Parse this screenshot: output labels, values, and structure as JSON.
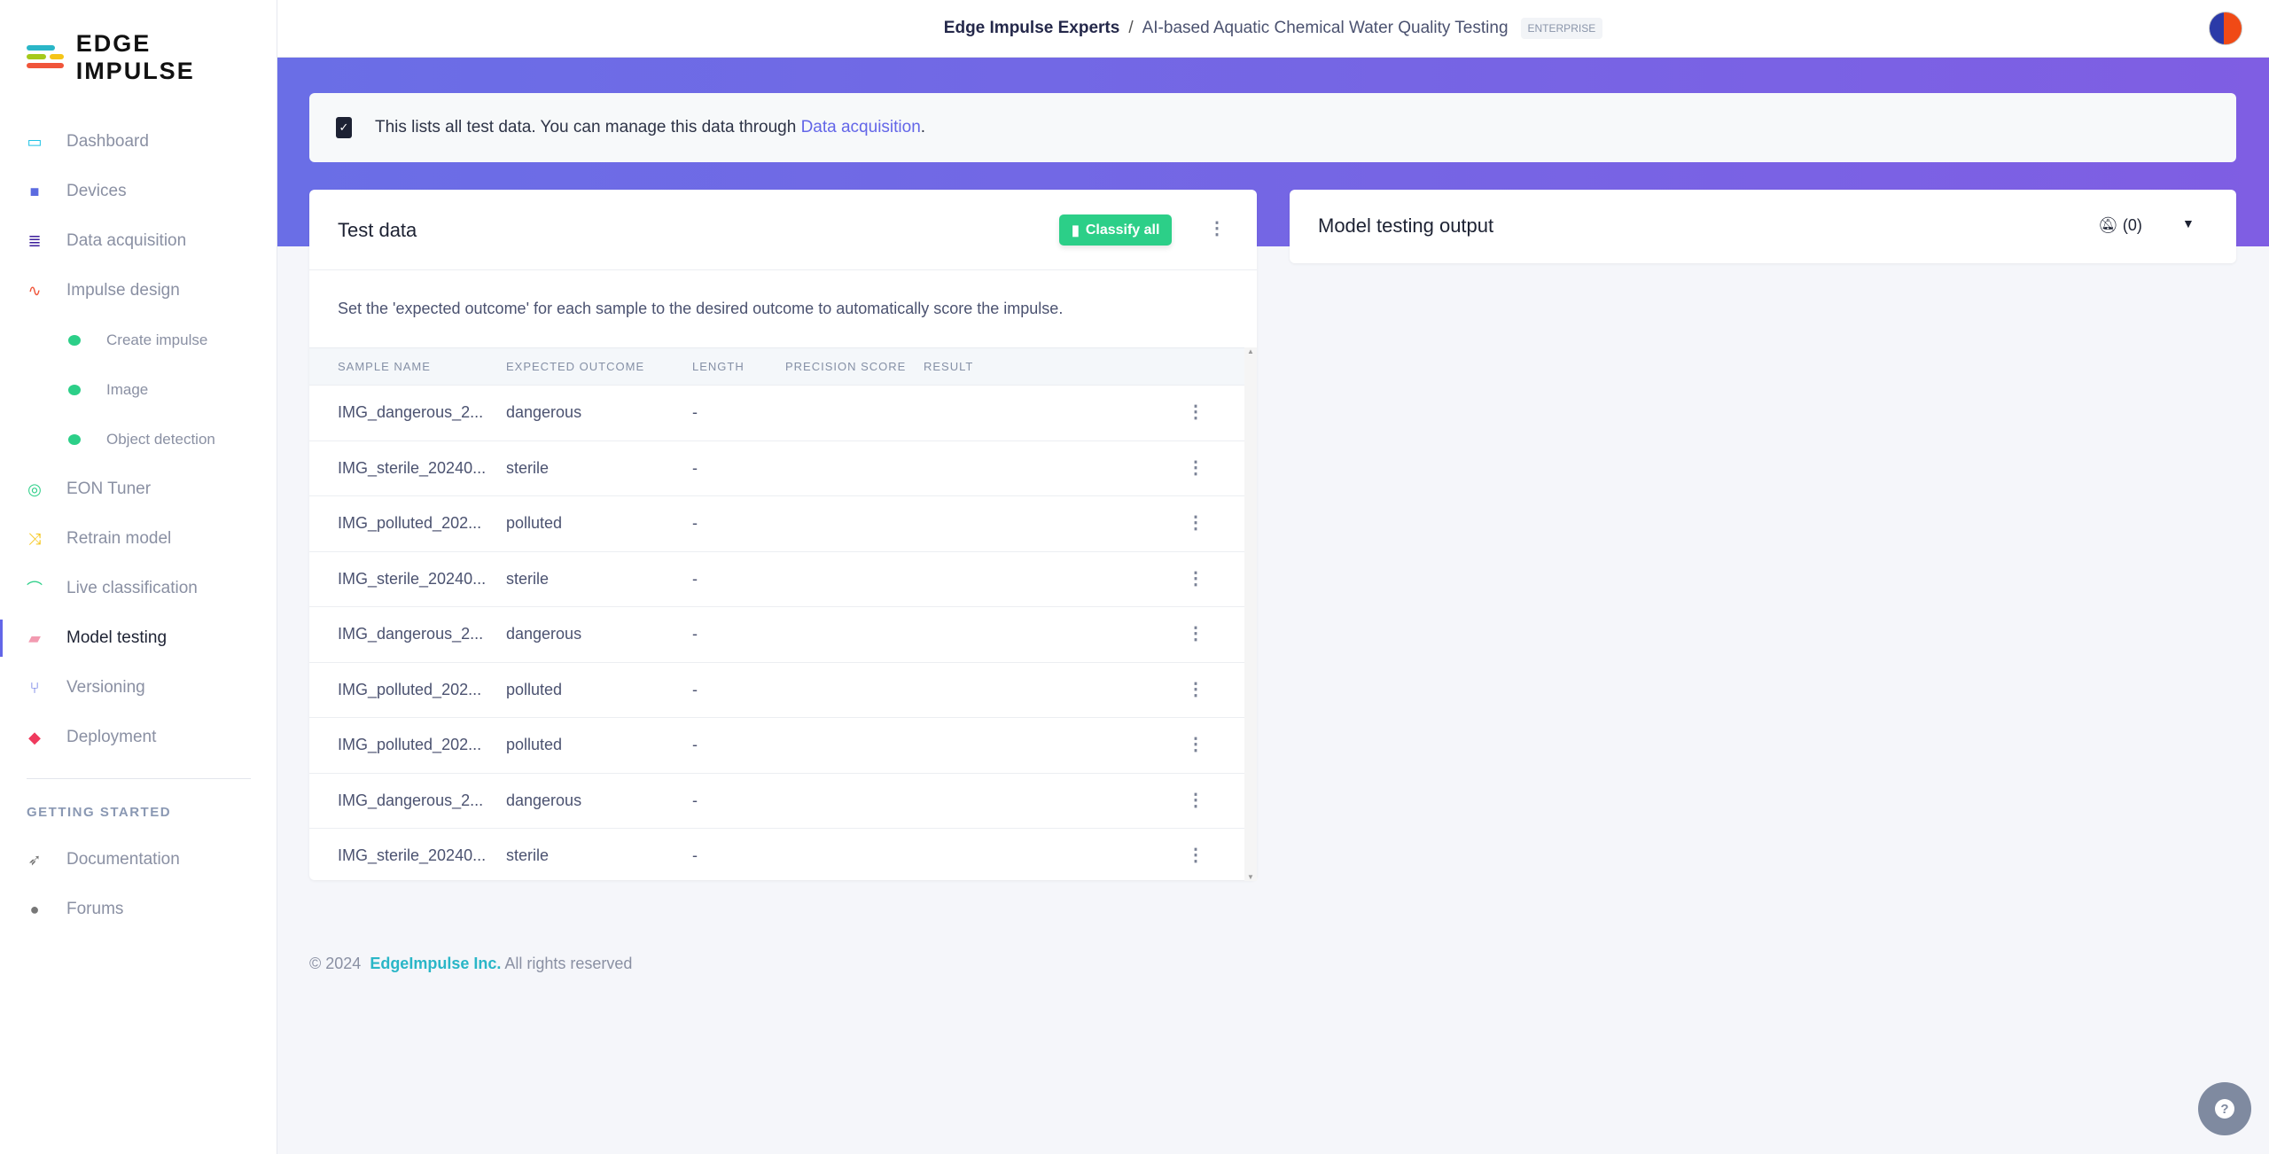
{
  "brand": {
    "name": "EDGE IMPULSE"
  },
  "sidebar": {
    "items": [
      {
        "label": "Dashboard",
        "icon": "monitor-icon",
        "color": "#22c3e6"
      },
      {
        "label": "Devices",
        "icon": "chip-icon",
        "color": "#5b6be0"
      },
      {
        "label": "Data acquisition",
        "icon": "database-icon",
        "color": "#3b1d9b"
      },
      {
        "label": "Impulse design",
        "icon": "pulse-icon",
        "color": "#f0553a"
      },
      {
        "label": "Create impulse",
        "sub": true
      },
      {
        "label": "Image",
        "sub": true
      },
      {
        "label": "Object detection",
        "sub": true
      },
      {
        "label": "EON Tuner",
        "icon": "compass-icon",
        "color": "#2ccf88"
      },
      {
        "label": "Retrain model",
        "icon": "shuffle-icon",
        "color": "#f5c518"
      },
      {
        "label": "Live classification",
        "icon": "bezier-icon",
        "color": "#2ccf88"
      },
      {
        "label": "Model testing",
        "icon": "clipboard-check-icon",
        "color": "#f29ab0",
        "active": true
      },
      {
        "label": "Versioning",
        "icon": "branch-icon",
        "color": "#5b6be0"
      },
      {
        "label": "Deployment",
        "icon": "box-icon",
        "color": "#ef3a5d"
      }
    ],
    "section": "GETTING STARTED",
    "links": [
      {
        "label": "Documentation",
        "icon": "rocket-icon"
      },
      {
        "label": "Forums",
        "icon": "comments-icon"
      }
    ]
  },
  "header": {
    "org": "Edge Impulse Experts",
    "separator": "/",
    "project": "AI-based Aquatic Chemical Water Quality Testing",
    "badge": "ENTERPRISE"
  },
  "info": {
    "text": "This lists all test data. You can manage this data through ",
    "link": "Data acquisition",
    "suffix": "."
  },
  "test_data": {
    "title": "Test data",
    "classify_label": "Classify all",
    "description": "Set the 'expected outcome' for each sample to the desired outcome to automatically score the impulse.",
    "columns": [
      "SAMPLE NAME",
      "EXPECTED OUTCOME",
      "LENGTH",
      "PRECISION SCORE",
      "RESULT"
    ],
    "rows": [
      {
        "name": "IMG_dangerous_2...",
        "outcome": "dangerous",
        "length": "-"
      },
      {
        "name": "IMG_sterile_20240...",
        "outcome": "sterile",
        "length": "-"
      },
      {
        "name": "IMG_polluted_202...",
        "outcome": "polluted",
        "length": "-"
      },
      {
        "name": "IMG_sterile_20240...",
        "outcome": "sterile",
        "length": "-"
      },
      {
        "name": "IMG_dangerous_2...",
        "outcome": "dangerous",
        "length": "-"
      },
      {
        "name": "IMG_polluted_202...",
        "outcome": "polluted",
        "length": "-"
      },
      {
        "name": "IMG_polluted_202...",
        "outcome": "polluted",
        "length": "-"
      },
      {
        "name": "IMG_dangerous_2...",
        "outcome": "dangerous",
        "length": "-"
      },
      {
        "name": "IMG_sterile_20240...",
        "outcome": "sterile",
        "length": "-"
      }
    ]
  },
  "output": {
    "title": "Model testing output",
    "notifications": "(0)"
  },
  "footer": {
    "copy": "© 2024",
    "company": "EdgeImpulse Inc.",
    "rights": "All rights reserved"
  },
  "help": {
    "label": "?"
  }
}
